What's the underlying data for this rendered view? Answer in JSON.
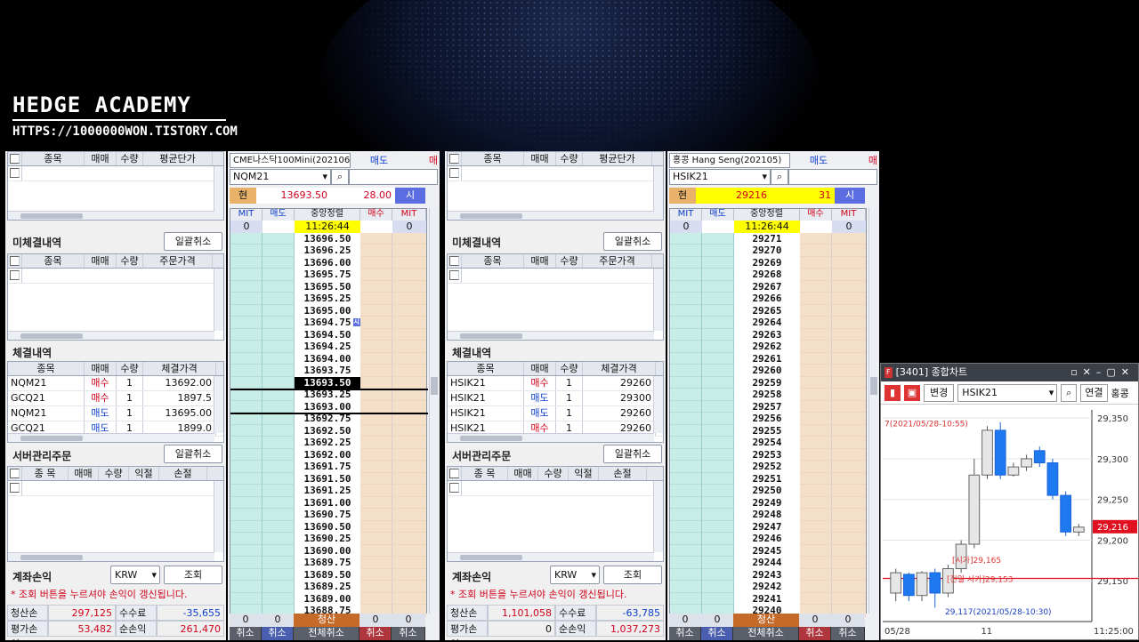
{
  "brand": {
    "title": "HEDGE ACADEMY",
    "url": "HTTPS://1000000WON.TISTORY.COM"
  },
  "left": {
    "positions_header": [
      "종목",
      "매매",
      "수량",
      "평균단가"
    ],
    "unfilled_title": "미체결내역",
    "bulk_cancel": "일괄취소",
    "unfilled_header": [
      "종목",
      "매매",
      "수량",
      "주문가격"
    ],
    "fills_title": "체결내역",
    "fills_header": [
      "종목",
      "매매",
      "수량",
      "체결가격"
    ],
    "fills": [
      [
        "NQM21",
        "매수",
        "1",
        "13692.00"
      ],
      [
        "GCQ21",
        "매수",
        "1",
        "1897.5"
      ],
      [
        "NQM21",
        "매도",
        "1",
        "13695.00"
      ],
      [
        "GCQ21",
        "매도",
        "1",
        "1899.0"
      ]
    ],
    "server_title": "서버관리주문",
    "server_cancel": "일괄취소",
    "server_header": [
      "종 목",
      "매매",
      "수량",
      "익절",
      "손절"
    ],
    "pnl_title": "계좌손익",
    "currency": "KRW",
    "query": "조회",
    "notice": "* 조회 버튼을 누르셔야 손익이 갱신됩니다.",
    "sum": {
      "l1": "청산손익",
      "v1": "297,125",
      "l2": "수수료",
      "v2": "-35,655",
      "l3": "평가손익",
      "v3": "53,482",
      "l4": "순손익",
      "v4": "261,470"
    }
  },
  "right": {
    "fills": [
      [
        "HSIK21",
        "매수",
        "1",
        "29260"
      ],
      [
        "HSIK21",
        "매도",
        "1",
        "29300"
      ],
      [
        "HSIK21",
        "매도",
        "1",
        "29260"
      ],
      [
        "HSIK21",
        "매수",
        "1",
        "29260"
      ]
    ],
    "sum": {
      "l1": "청산손익",
      "v1": "1,101,058",
      "l2": "수수료",
      "v2": "-63,785",
      "l3": "평가손익",
      "v3": "0",
      "l4": "순손익",
      "v4": "1,037,273"
    }
  },
  "ob1": {
    "instrument": "CME나스닥100Mini(202106)",
    "code": "NQM21",
    "sell_tab": "매도",
    "buy_tab": "매",
    "cur_label": "현",
    "price": "13693.50",
    "change": "28.00",
    "market": "시",
    "cols": [
      "MIT",
      "매도",
      "중앙정렬",
      "매수",
      "MIT"
    ],
    "mit_l": "0",
    "mit_r": "0",
    "time": "11:26:44",
    "prices": [
      "13696.50",
      "13696.25",
      "13696.00",
      "13695.75",
      "13695.50",
      "13695.25",
      "13695.00",
      "13694.75",
      "13694.50",
      "13694.25",
      "13694.00",
      "13693.75",
      "13693.50",
      "13693.25",
      "13693.00",
      "13692.75",
      "13692.50",
      "13692.25",
      "13692.00",
      "13691.75",
      "13691.50",
      "13691.25",
      "13691.00",
      "13690.75",
      "13690.50",
      "13690.25",
      "13690.00",
      "13689.75",
      "13689.50",
      "13689.25",
      "13689.00",
      "13688.75"
    ],
    "current_index": 12,
    "mark_index": 7,
    "mark": "시",
    "bottom_vals": [
      "0",
      "0",
      "청산",
      "0",
      "0"
    ],
    "bottom_btns": [
      "취소",
      "취소",
      "전체취소",
      "취소",
      "취소"
    ]
  },
  "ob2": {
    "instrument": "홍콩 Hang Seng(202105)",
    "code": "HSIK21",
    "sell_tab": "매도",
    "buy_tab": "매",
    "cur_label": "현",
    "price": "29216",
    "change": "31",
    "market": "시",
    "cols": [
      "MIT",
      "매도",
      "중앙정렬",
      "매수",
      "MIT"
    ],
    "mit_l": "0",
    "mit_r": "0",
    "time": "11:26:44",
    "prices": [
      "29271",
      "29270",
      "29269",
      "29268",
      "29267",
      "29266",
      "29265",
      "29264",
      "29263",
      "29262",
      "29261",
      "29260",
      "29259",
      "29258",
      "29257",
      "29256",
      "29255",
      "29254",
      "29253",
      "29252",
      "29251",
      "29250",
      "29249",
      "29248",
      "29247",
      "29246",
      "29245",
      "29244",
      "29243",
      "29242",
      "29241",
      "29240"
    ],
    "bottom_vals": [
      "0",
      "0",
      "청산",
      "0",
      "0"
    ],
    "bottom_btns": [
      "취소",
      "취소",
      "전체취소",
      "취소",
      "취소"
    ]
  },
  "chart": {
    "title": "[3401] 종합차트",
    "change_btn": "변경",
    "code": "HSIK21",
    "connect": "연결",
    "more": "홍콩",
    "annot_high": "7(2021/05/28-10:55)",
    "annot_open": "[시가]29,165",
    "annot_prevopen": "[전일 시가]29,153",
    "annot_low": "29,117(2021/05/28-10:30)",
    "yticks": [
      "29,350",
      "29,300",
      "29,250",
      "29,200",
      "29,150"
    ],
    "xticks": [
      "05/28",
      "11",
      "11:25:00"
    ],
    "last": "29,216"
  },
  "chart_data": {
    "type": "candlestick",
    "ylim": [
      29100,
      29360
    ],
    "candles": [
      [
        29135,
        29160,
        29125,
        29165
      ],
      [
        29158,
        29132,
        29125,
        29160
      ],
      [
        29132,
        29160,
        29125,
        29162
      ],
      [
        29160,
        29135,
        29117,
        29165
      ],
      [
        29135,
        29165,
        29130,
        29170
      ],
      [
        29165,
        29195,
        29160,
        29200
      ],
      [
        29195,
        29280,
        29190,
        29300
      ],
      [
        29280,
        29335,
        29275,
        29340
      ],
      [
        29335,
        29280,
        29275,
        29345
      ],
      [
        29280,
        29290,
        29278,
        29295
      ],
      [
        29290,
        29300,
        29285,
        29305
      ],
      [
        29310,
        29295,
        29290,
        29315
      ],
      [
        29295,
        29255,
        29250,
        29300
      ],
      [
        29255,
        29210,
        29205,
        29260
      ],
      [
        29210,
        29216,
        29205,
        29220
      ]
    ]
  }
}
